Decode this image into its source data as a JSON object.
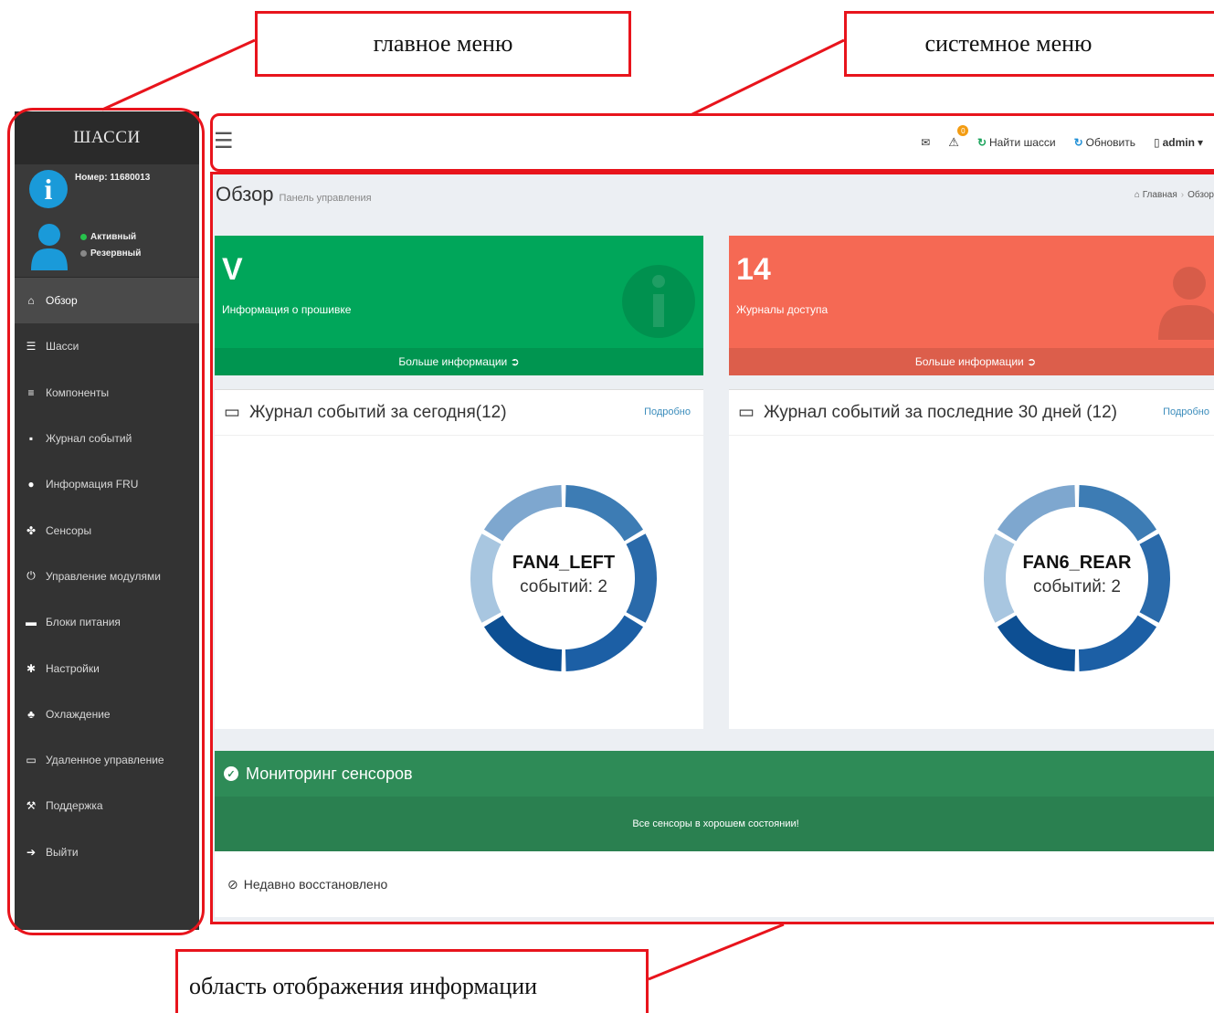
{
  "annotations": {
    "main_menu": "главное меню",
    "system_menu": "системное меню",
    "info_area": "область отображения информации"
  },
  "sidebar": {
    "title": "ШАССИ",
    "number_label": "Номер: 11680013",
    "status_active": "Активный",
    "status_reserve": "Резервный",
    "items": [
      {
        "label": "Обзор",
        "icon": "home-icon"
      },
      {
        "label": "Шасси",
        "icon": "list-icon"
      },
      {
        "label": "Компоненты",
        "icon": "components-icon"
      },
      {
        "label": "Журнал событий",
        "icon": "file-icon"
      },
      {
        "label": "Информация FRU",
        "icon": "info-icon"
      },
      {
        "label": "Сенсоры",
        "icon": "sensors-icon"
      },
      {
        "label": "Управление модулями",
        "icon": "power-icon"
      },
      {
        "label": "Блоки питания",
        "icon": "battery-icon"
      },
      {
        "label": "Настройки",
        "icon": "settings-icon"
      },
      {
        "label": "Охлаждение",
        "icon": "fan-icon"
      },
      {
        "label": "Удаленное управление",
        "icon": "monitor-icon"
      },
      {
        "label": "Поддержка",
        "icon": "wrench-icon"
      },
      {
        "label": "Выйти",
        "icon": "logout-icon"
      }
    ]
  },
  "topbar": {
    "warning_badge": "0",
    "find_chassis": "Найти шасси",
    "refresh": "Обновить",
    "user": "admin"
  },
  "content": {
    "title": "Обзор",
    "subtitle": "Панель управления",
    "breadcrumb_home": "Главная",
    "breadcrumb_current": "Обзор",
    "tile_firmware": {
      "value": "V",
      "label": "Информация о прошивке",
      "more": "Больше информации"
    },
    "tile_access": {
      "value": "14",
      "label": "Журналы доступа",
      "more": "Больше информации"
    },
    "panel_today": {
      "title": "Журнал событий за сегодня(12)",
      "more": "Подробно",
      "center_name": "FAN4_LEFT",
      "center_count": "событий: 2",
      "segments": [
        2,
        2,
        2,
        2,
        2,
        2
      ]
    },
    "panel_30days": {
      "title": "Журнал событий за последние 30 дней (12)",
      "more": "Подробно",
      "center_name": "FAN6_REAR",
      "center_count": "событий: 2",
      "segments": [
        2,
        2,
        2,
        2,
        2,
        2
      ]
    },
    "monitoring": {
      "title": "Мониторинг сенсоров",
      "message": "Все сенсоры в хорошем состоянии!"
    },
    "recent": "Недавно восстановлено"
  },
  "colors": {
    "donut": [
      "#3d7cb4",
      "#2a6aaa",
      "#1c5fa5",
      "#0d4f93",
      "#a8c6e0",
      "#7ea7cf"
    ],
    "green_tile": "#00a65a",
    "red_tile": "#f56954",
    "monitor": "#2e8b57"
  }
}
